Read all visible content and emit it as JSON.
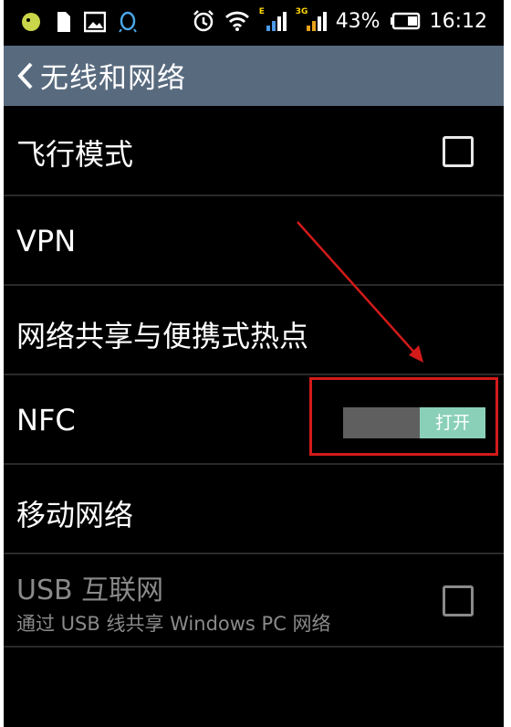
{
  "status_bar": {
    "battery_percent": "43%",
    "time": "16:12",
    "network_tags": [
      "E",
      "3G"
    ]
  },
  "header": {
    "title": "无线和网络"
  },
  "settings": {
    "airplane_mode": {
      "label": "飞行模式",
      "checked": false
    },
    "vpn": {
      "label": "VPN"
    },
    "tethering": {
      "label": "网络共享与便携式热点"
    },
    "nfc": {
      "label": "NFC",
      "toggle_label": "打开",
      "enabled": true
    },
    "mobile_network": {
      "label": "移动网络"
    },
    "usb_internet": {
      "label": "USB 互联网",
      "summary": "通过 USB 线共享 Windows PC 网络",
      "checked": false,
      "disabled": true
    }
  },
  "colors": {
    "action_bar": "#586a7e",
    "toggle_on": "#8ad0b8",
    "annotation": "#d31a1a"
  }
}
